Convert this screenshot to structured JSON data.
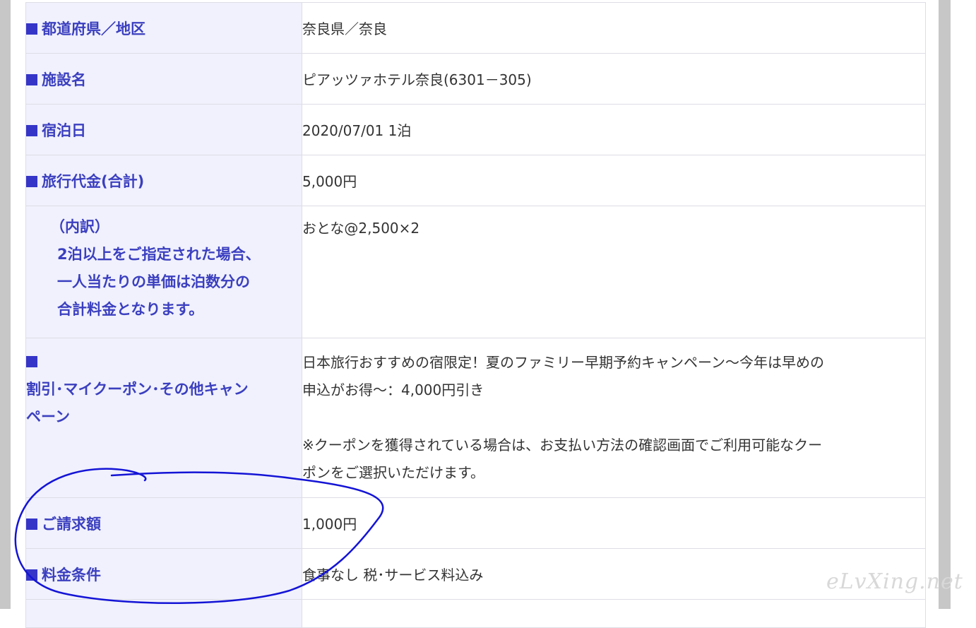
{
  "rows": [
    {
      "label": "都道府県／地区",
      "value": "奈良県／奈良"
    },
    {
      "label": "施設名",
      "value": "ピアッツァホテル奈良(6301－305)"
    },
    {
      "label": "宿泊日",
      "value": "2020/07/01 1泊"
    },
    {
      "label": "旅行代金(合計)",
      "value": "5,000円"
    }
  ],
  "breakdown": {
    "lines": [
      "（内訳）",
      "2泊以上をご指定された場合、",
      "一人当たりの単価は泊数分の",
      "合計料金となります。"
    ],
    "value": "おとな@2,500×2"
  },
  "campaign": {
    "label_lines": [
      "割引･マイクーポン･その他キャン",
      "ペーン"
    ],
    "value_lines": [
      "日本旅行おすすめの宿限定！夏のファミリー早期予約キャンペーン～今年は早めの",
      "申込がお得～：4,000円引き",
      "",
      "※クーポンを獲得されている場合は、お支払い方法の確認画面でご利用可能なクー",
      "ポンをご選択いただけます。"
    ]
  },
  "billing": {
    "label": "ご請求額",
    "value": "1,000円"
  },
  "conditions": {
    "label": "料金条件",
    "value": "食事なし 税･サービス料込み"
  },
  "watermark": "eLvXing.net",
  "colors": {
    "label_text": "#3b3fbf",
    "label_bg": "#f0f1fc",
    "square": "#3535c8",
    "annotation": "#1414d6"
  }
}
